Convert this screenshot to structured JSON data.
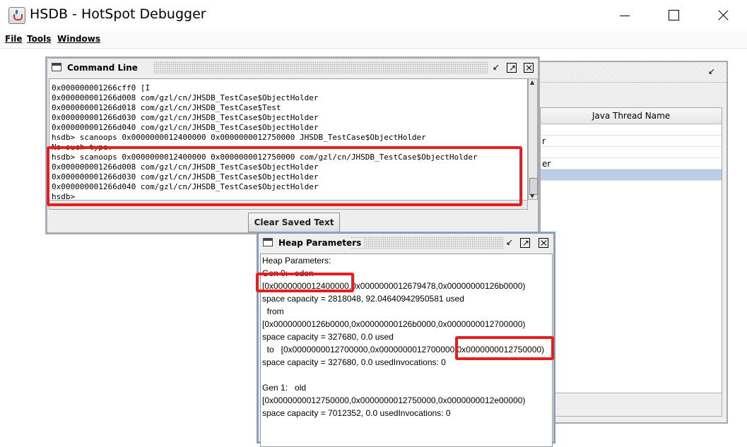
{
  "window": {
    "title": "HSDB - HotSpot Debugger"
  },
  "menu": [
    {
      "label": "File"
    },
    {
      "label": "Tools"
    },
    {
      "label": "Windows"
    }
  ],
  "thread_frame": {
    "column_header": "Java Thread Name",
    "rows": [
      "",
      "r",
      "",
      "er",
      ""
    ]
  },
  "command_line": {
    "title": "Command Line",
    "lines": [
      "0x000000001266cff0 [I",
      "0x000000001266d008 com/gzl/cn/JHSDB_TestCase$ObjectHolder",
      "0x000000001266d018 com/gzl/cn/JHSDB_TestCase$Test",
      "0x000000001266d030 com/gzl/cn/JHSDB_TestCase$ObjectHolder",
      "0x000000001266d040 com/gzl/cn/JHSDB_TestCase$ObjectHolder",
      "hsdb> scanoops 0x0000000012400000 0x0000000012750000 JHSDB_TestCase$ObjectHolder",
      "No such type.",
      "hsdb> scanoops 0x0000000012400000 0x0000000012750000 com/gzl/cn/JHSDB_TestCase$ObjectHolder",
      "0x000000001266d008 com/gzl/cn/JHSDB_TestCase$ObjectHolder",
      "0x000000001266d030 com/gzl/cn/JHSDB_TestCase$ObjectHolder",
      "0x000000001266d040 com/gzl/cn/JHSDB_TestCase$ObjectHolder",
      "hsdb> "
    ],
    "clear_button": "Clear Saved Text"
  },
  "heap_parameters": {
    "title": "Heap Parameters",
    "lines": [
      "Heap Parameters:",
      "Gen 0:   eden",
      "[0x0000000012400000,0x0000000012679478,0x00000000126b0000)",
      "space capacity = 2818048, 92.04640942950581 used",
      "  from",
      "[0x00000000126b0000,0x00000000126b0000,0x0000000012700000)",
      "space capacity = 327680, 0.0 used",
      "  to   [0x0000000012700000,0x0000000012700000,0x0000000012750000)",
      "space capacity = 327680, 0.0 usedInvocations: 0",
      "",
      "Gen 1:   old",
      "[0x0000000012750000,0x0000000012750000,0x0000000012e00000)",
      "space capacity = 7012352, 0.0 usedInvocations: 0"
    ]
  },
  "colors": {
    "highlight": "#e32020",
    "selection": "#b8cfe5"
  }
}
